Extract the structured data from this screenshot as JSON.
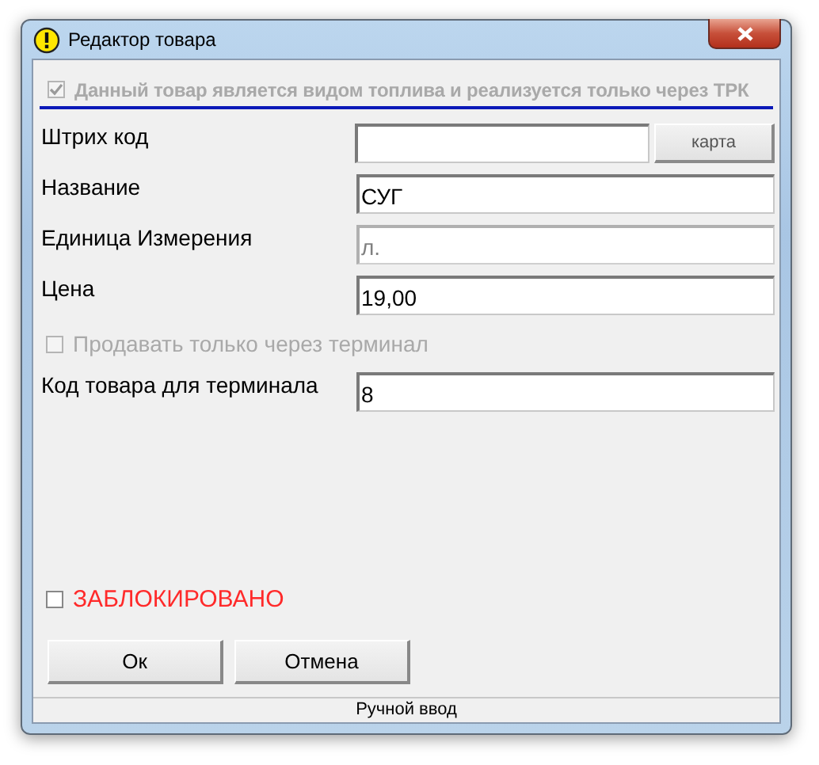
{
  "window": {
    "title": "Редактор товара"
  },
  "fuel_checkbox": {
    "label": "Данный товар является видом топлива и реализуется только через ТРК",
    "checked": true,
    "disabled": true
  },
  "rows": [
    {
      "kind": "field",
      "label": "Штрих код",
      "button": "карта"
    },
    {
      "kind": "field",
      "label": "Название",
      "value": "СУГ"
    },
    {
      "kind": "field",
      "label": "Единица Измерения",
      "value": "л.",
      "disabled": true
    },
    {
      "kind": "field",
      "label": "Цена",
      "value": "19,00"
    },
    {
      "kind": "checkbox",
      "label": "Продавать только через терминал",
      "checked": false,
      "disabled": true
    },
    {
      "kind": "field",
      "label": "Код товара для терминала",
      "value": "8"
    }
  ],
  "blocked_checkbox": {
    "label": "ЗАБЛОКИРОВАНО",
    "checked": false
  },
  "buttons": [
    "Ок",
    "Отмена"
  ],
  "status_bar": "Ручной ввод"
}
